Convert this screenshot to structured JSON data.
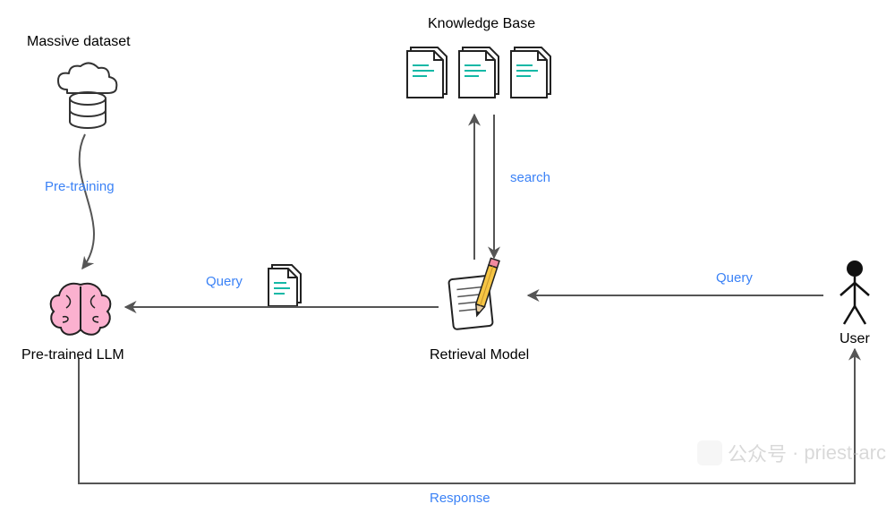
{
  "diagram": {
    "nodes": {
      "massive_dataset": {
        "title": "Massive dataset",
        "icon": "cloud-database"
      },
      "knowledge_base": {
        "title": "Knowledge Base",
        "icon": "documents-stack"
      },
      "pretrained_llm": {
        "title": "Pre-trained LLM",
        "icon": "brain"
      },
      "retrieval_model": {
        "title": "Retrieval Model",
        "icon": "notepad-pencil"
      },
      "user": {
        "title": "User",
        "icon": "person"
      }
    },
    "edges": {
      "pretraining": {
        "label": "Pre-training",
        "from": "massive_dataset",
        "to": "pretrained_llm"
      },
      "search": {
        "label": "search",
        "from": "retrieval_model",
        "to": "knowledge_base",
        "bidirectional": true
      },
      "query_rm_to_llm": {
        "label": "Query",
        "from": "retrieval_model",
        "to": "pretrained_llm",
        "with_doc_icon": true
      },
      "query_user_to_rm": {
        "label": "Query",
        "from": "user",
        "to": "retrieval_model"
      },
      "response": {
        "label": "Response",
        "from": "pretrained_llm",
        "to": "user"
      }
    }
  },
  "watermark": {
    "prefix": "公众号",
    "separator": "·",
    "name": "priest-arc"
  }
}
